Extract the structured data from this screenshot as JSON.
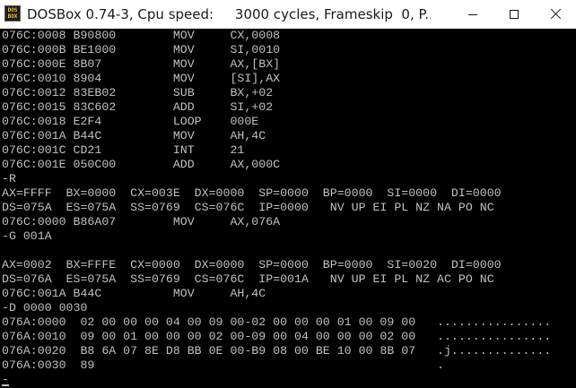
{
  "window": {
    "title": "DOSBox 0.74-3, Cpu speed:     3000 cycles, Frameskip  0, P...",
    "icon": "dosbox-icon",
    "icon_text": [
      "DOS",
      "BOX"
    ],
    "controls": {
      "minimize": "minimize-icon",
      "maximize": "maximize-icon",
      "close": "close-icon"
    }
  },
  "colors": {
    "console_background": "#000000",
    "console_text": "#c0c0c0",
    "titlebar_background": "#ffffff"
  },
  "console": {
    "lines": [
      "076C:0008 B90800        MOV     CX,0008",
      "076C:000B BE1000        MOV     SI,0010",
      "076C:000E 8B07          MOV     AX,[BX]",
      "076C:0010 8904          MOV     [SI],AX",
      "076C:0012 83EB02        SUB     BX,+02",
      "076C:0015 83C602        ADD     SI,+02",
      "076C:0018 E2F4          LOOP    000E",
      "076C:001A B44C          MOV     AH,4C",
      "076C:001C CD21          INT     21",
      "076C:001E 050C00        ADD     AX,000C",
      "-R",
      "AX=FFFF  BX=0000  CX=003E  DX=0000  SP=0000  BP=0000  SI=0000  DI=0000",
      "DS=075A  ES=075A  SS=0769  CS=076C  IP=0000   NV UP EI PL NZ NA PO NC",
      "076C:0000 B86A07        MOV     AX,076A",
      "-G 001A",
      "",
      "AX=0002  BX=FFFE  CX=0000  DX=0000  SP=0000  BP=0000  SI=0020  DI=0000",
      "DS=076A  ES=075A  SS=0769  CS=076C  IP=001A   NV UP EI PL NZ AC PO NC",
      "076C:001A B44C          MOV     AH,4C",
      "-D 0000 0030",
      "076A:0000  02 00 00 00 04 00 09 00-02 00 00 00 01 00 09 00   ................",
      "076A:0010  09 00 01 00 00 00 02 00-09 00 04 00 00 00 02 00   ................",
      "076A:0020  B8 6A 07 8E D8 BB 0E 00-B9 08 00 BE 10 00 8B 07   .j..............",
      "076A:0030  89                                                .",
      "-"
    ]
  }
}
